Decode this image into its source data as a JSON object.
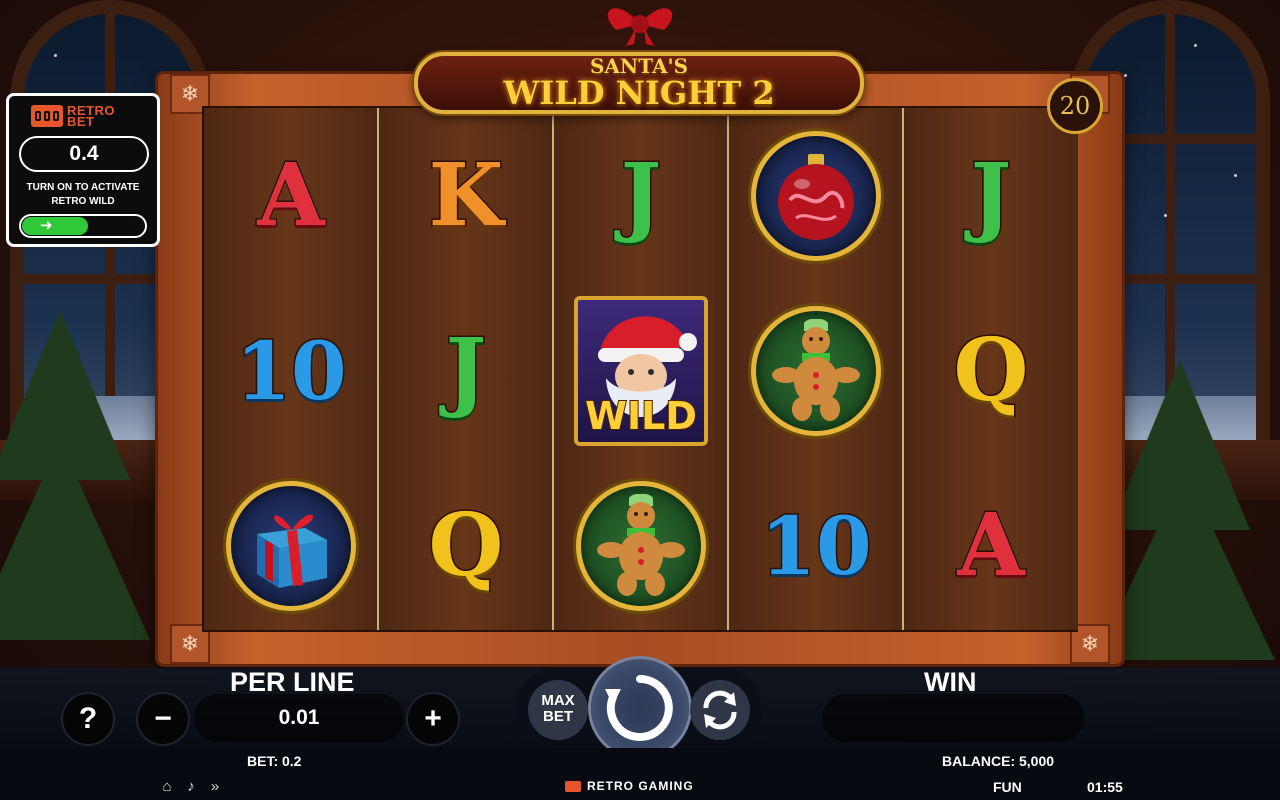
{
  "game": {
    "title_top": "SANTA'S",
    "title_main": "WILD NIGHT 2",
    "paylines": "20"
  },
  "reels": [
    [
      {
        "kind": "glyph",
        "text": "A",
        "color": "red"
      },
      {
        "kind": "glyph",
        "text": "10",
        "color": "blue"
      },
      {
        "kind": "icon",
        "icon": "gift-icon"
      }
    ],
    [
      {
        "kind": "glyph",
        "text": "K",
        "color": "orange"
      },
      {
        "kind": "glyph",
        "text": "J",
        "color": "green"
      },
      {
        "kind": "glyph",
        "text": "Q",
        "color": "gold"
      }
    ],
    [
      {
        "kind": "glyph",
        "text": "J",
        "color": "green"
      },
      {
        "kind": "wild",
        "text": "WILD",
        "icon": "santa-icon"
      },
      {
        "kind": "icon",
        "icon": "gingerbread-man-icon"
      }
    ],
    [
      {
        "kind": "icon",
        "icon": "ornament-icon"
      },
      {
        "kind": "icon",
        "icon": "gingerbread-man-icon"
      },
      {
        "kind": "glyph",
        "text": "10",
        "color": "blue"
      }
    ],
    [
      {
        "kind": "glyph",
        "text": "J",
        "color": "green"
      },
      {
        "kind": "glyph",
        "text": "Q",
        "color": "gold"
      },
      {
        "kind": "glyph",
        "text": "A",
        "color": "red"
      }
    ]
  ],
  "retro_bet": {
    "logo_line1": "RETRO",
    "logo_line2": "BET",
    "value": "0.4",
    "text_line1": "TURN ON TO ACTIVATE",
    "text_line2": "RETRO WILD",
    "toggle_icon": "arrow-right-icon"
  },
  "controls": {
    "per_line_label": "PER LINE",
    "per_line_value": "0.01",
    "help_label": "?",
    "minus_label": "−",
    "plus_label": "+",
    "max_bet_line1": "MAX",
    "max_bet_line2": "BET",
    "win_label": "WIN",
    "win_value": ""
  },
  "info": {
    "bet": "BET: 0.2",
    "balance": "BALANCE: 5,000",
    "brand": "RETRO GAMING",
    "mode": "FUN",
    "time": "01:55"
  },
  "colors": {
    "accent_gold": "#e2b23f",
    "toggle_green": "#2fc93a",
    "retro_orange": "#e8552c",
    "frame_wood": "#c4622c"
  }
}
